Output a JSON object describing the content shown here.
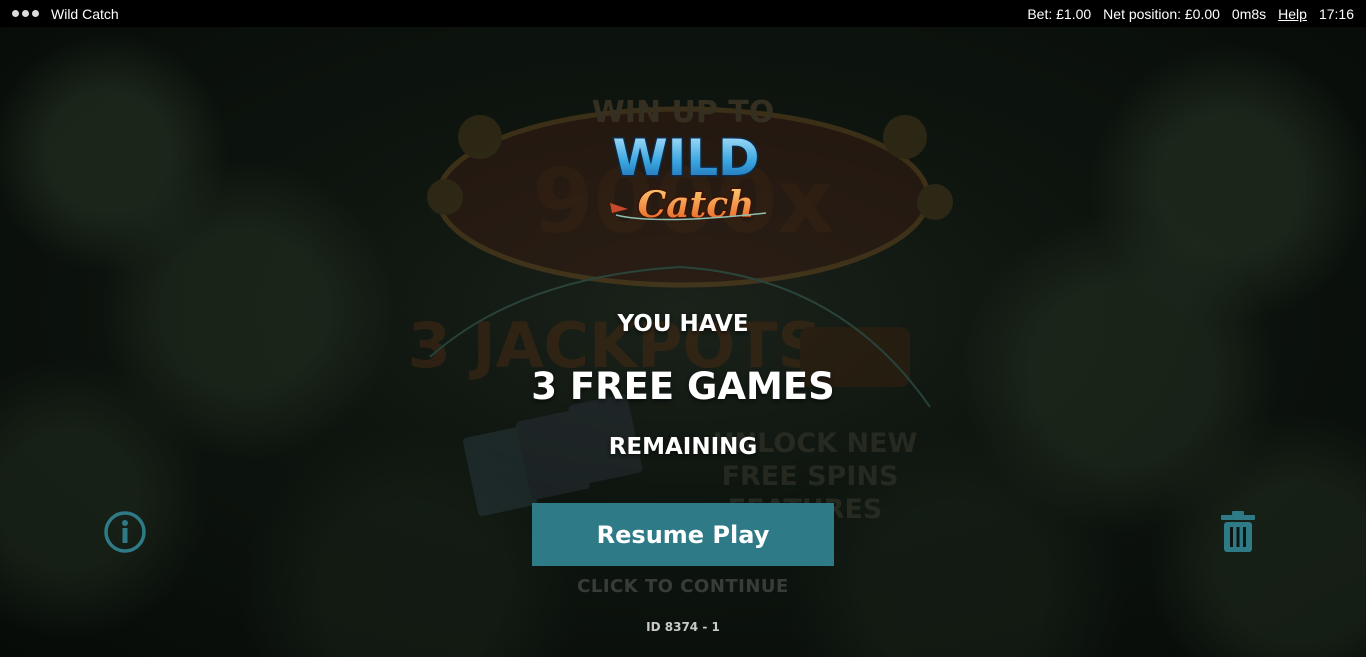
{
  "topbar": {
    "game_title": "Wild Catch",
    "bet": "Bet: £1.00",
    "net_position": "Net position: £0.00",
    "session_time": "0m8s",
    "help_label": "Help",
    "clock": "17:16"
  },
  "background": {
    "win_up_to": "WIN UP TO",
    "multiplier": "9000x",
    "jackpots": "3 JACKPOTS",
    "unlock_line_1": "UNLOCK NEW",
    "unlock_line_2": "FREE SPINS",
    "unlock_line_3": "FEATURES"
  },
  "logo": {
    "word_1": "WILD",
    "word_2": "Catch"
  },
  "message": {
    "line_1": "YOU HAVE",
    "line_2": "3 FREE GAMES",
    "line_3": "REMAINING"
  },
  "resume_button_label": "Resume Play",
  "click_to_continue": "CLICK TO CONTINUE",
  "round_id": "ID 8374 - 1",
  "icons": {
    "info": "info-icon",
    "trash": "trash-icon",
    "menu": "menu-dots-icon"
  },
  "colors": {
    "accent": "#2f7a87",
    "icon": "#2f7a87",
    "background": "#0e150f"
  }
}
